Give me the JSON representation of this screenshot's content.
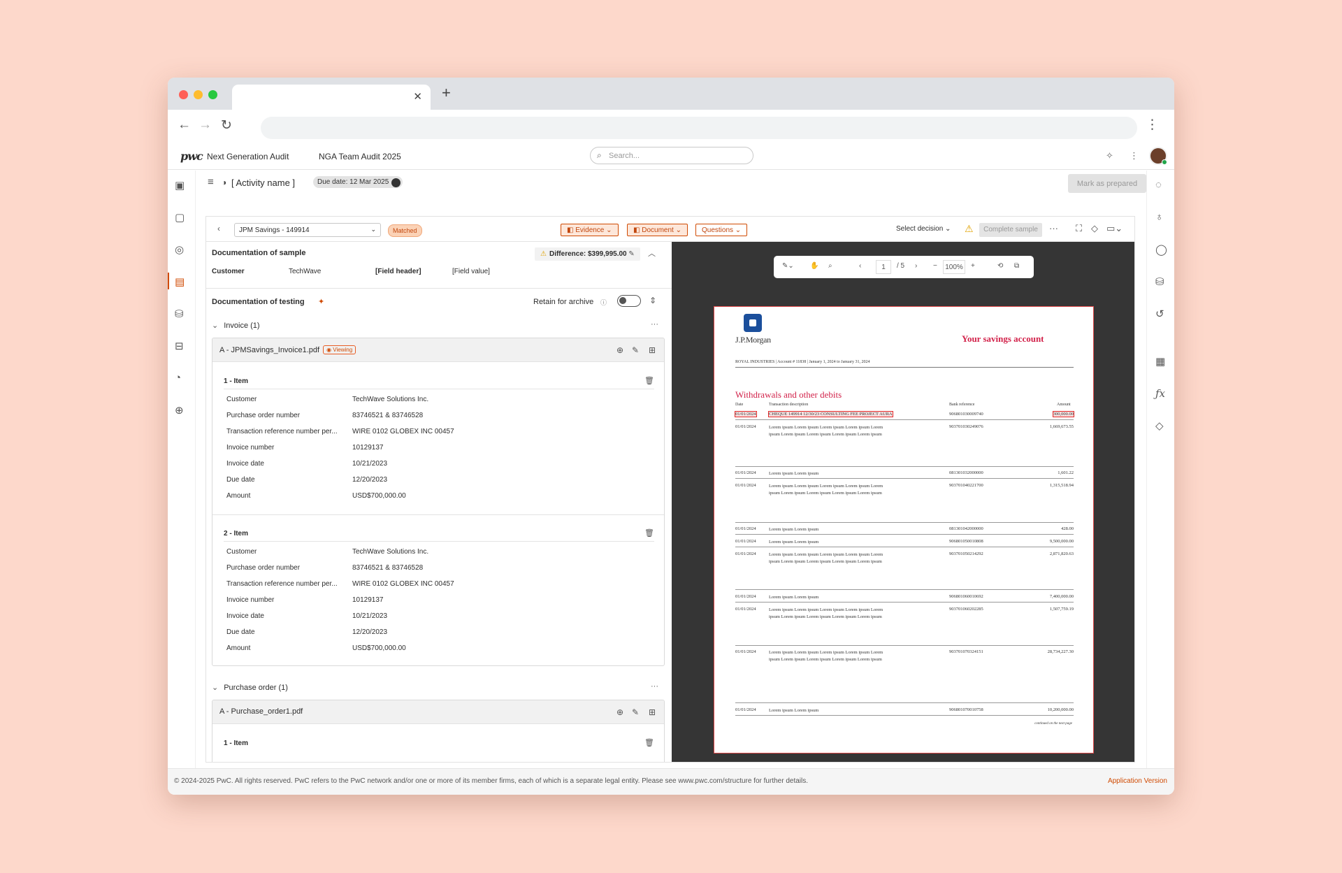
{
  "app": {
    "product": "Next Generation Audit",
    "engagement": "NGA Team Audit 2025",
    "search_placeholder": "Search...",
    "activity_name": "[ Activity name ]",
    "due_date": "Due date: 12 Mar 2025",
    "mark_prepared": "Mark as prepared"
  },
  "toolbar": {
    "sample": "JPM Savings - 149914",
    "status": "Matched",
    "evidence": "Evidence",
    "document": "Document",
    "questions": "Questions",
    "select_decision": "Select decision",
    "complete_sample": "Complete sample"
  },
  "doc_sample": {
    "title": "Documentation of sample",
    "difference": "Difference: $399,995.00",
    "customer_label": "Customer",
    "customer_value": "TechWave",
    "field_header": "[Field header]",
    "field_value": "[Field value]"
  },
  "doc_testing": {
    "title": "Documentation of testing",
    "retain": "Retain for archive"
  },
  "invoice_group": {
    "title": "Invoice (1)",
    "file": "A - JPMSavings_Invoice1.pdf",
    "viewing": "Viewing",
    "items": [
      {
        "title": "1 - Item",
        "rows": [
          {
            "k": "Customer",
            "v": "TechWave Solutions Inc."
          },
          {
            "k": "Purchase order number",
            "v": "83746521 & 83746528"
          },
          {
            "k": "Transaction reference number per...",
            "v": "WIRE 0102 GLOBEX INC 00457"
          },
          {
            "k": "Invoice number",
            "v": "10129137"
          },
          {
            "k": "Invoice date",
            "v": "10/21/2023"
          },
          {
            "k": "Due date",
            "v": "12/20/2023"
          },
          {
            "k": "Amount",
            "v": "USD$700,000.00"
          }
        ]
      },
      {
        "title": "2 - Item",
        "rows": [
          {
            "k": "Customer",
            "v": "TechWave Solutions Inc."
          },
          {
            "k": "Purchase order number",
            "v": "83746521 & 83746528"
          },
          {
            "k": "Transaction reference number per...",
            "v": "WIRE 0102 GLOBEX INC 00457"
          },
          {
            "k": "Invoice number",
            "v": "10129137"
          },
          {
            "k": "Invoice date",
            "v": "10/21/2023"
          },
          {
            "k": "Due date",
            "v": "12/20/2023"
          },
          {
            "k": "Amount",
            "v": "USD$700,000.00"
          }
        ]
      }
    ]
  },
  "po_group": {
    "title": "Purchase order (1)",
    "file": "A - Purchase_order1.pdf",
    "item_title": "1 - Item"
  },
  "viewer": {
    "page": "1",
    "page_total": "/ 5",
    "zoom": "100%"
  },
  "statement": {
    "bank": "J.P.Morgan",
    "title": "Your savings account",
    "subtitle": "ROYAL INDUSTRIES  |  Account # 11838  |  January 1, 2024 to January 31, 2024",
    "section": "Withdrawals and other debits",
    "headers": {
      "date": "Date",
      "desc": "Transaction description",
      "ref": "Bank reference",
      "amount": "Amount"
    },
    "rows": [
      {
        "date": "01/01/2024",
        "desc": "CHEQUE 149914 12/30/23 CONSULTING FEE PROJECT AURA",
        "ref": "906801030009740",
        "amount": "300,000.00"
      },
      {
        "date": "01/01/2024",
        "desc": "Lorem ipsum Lorem ipsum Lorem ipsum Lorem ipsum Lorem ipsum Lorem ipsum Lorem ipsum Lorem ipsum Lorem ipsum",
        "ref": "903701030249076",
        "amount": "1,669,673.55"
      },
      {
        "date": "01/01/2024",
        "desc": "Lorem ipsum Lorem ipsum",
        "ref": "081301032000000",
        "amount": "1,601.22"
      },
      {
        "date": "01/01/2024",
        "desc": "Lorem ipsum Lorem ipsum Lorem ipsum Lorem ipsum Lorem ipsum Lorem ipsum Lorem ipsum Lorem ipsum Lorem ipsum",
        "ref": "903701040221700",
        "amount": "1,315,518.94"
      },
      {
        "date": "01/01/2024",
        "desc": "Lorem ipsum Lorem ipsum",
        "ref": "081301042000000",
        "amount": "428.00"
      },
      {
        "date": "01/01/2024",
        "desc": "Lorem ipsum Lorem ipsum",
        "ref": "906801050010808",
        "amount": "9,500,000.00"
      },
      {
        "date": "01/01/2024",
        "desc": "Lorem ipsum Lorem ipsum Lorem ipsum Lorem ipsum Lorem ipsum Lorem ipsum Lorem ipsum Lorem ipsum Lorem ipsum",
        "ref": "903701050214292",
        "amount": "2,871,820.63"
      },
      {
        "date": "01/01/2024",
        "desc": "Lorem ipsum Lorem ipsum",
        "ref": "906801060010692",
        "amount": "7,400,000.00"
      },
      {
        "date": "01/01/2024",
        "desc": "Lorem ipsum Lorem ipsum Lorem ipsum Lorem ipsum Lorem ipsum Lorem ipsum Lorem ipsum Lorem ipsum Lorem ipsum",
        "ref": "903701060202285",
        "amount": "1,507,759.19"
      },
      {
        "date": "01/01/2024",
        "desc": "Lorem ipsum Lorem ipsum Lorem ipsum Lorem ipsum Lorem ipsum Lorem ipsum Lorem ipsum Lorem ipsum Lorem ipsum",
        "ref": "903701070324151",
        "amount": "28,734,227.30"
      },
      {
        "date": "01/01/2024",
        "desc": "Lorem ipsum Lorem ipsum",
        "ref": "906801070010758",
        "amount": "10,200,000.00"
      }
    ],
    "continued": "continued on the next page"
  },
  "footer": {
    "copyright": "© 2024-2025 PwC. All rights reserved. PwC refers to the PwC network and/or one or more of its member firms, each of which is a separate legal entity. Please see www.pwc.com/structure for further details.",
    "version": "Application Version"
  },
  "colors": {
    "accent": "#d04a02",
    "highlight": "#e02828",
    "bank_red": "#d2224a"
  }
}
